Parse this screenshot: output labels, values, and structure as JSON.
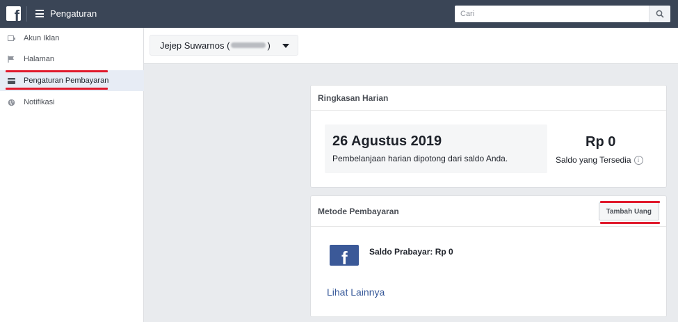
{
  "header": {
    "title": "Pengaturan",
    "search_placeholder": "Cari"
  },
  "sidebar": {
    "items": [
      {
        "label": "Akun Iklan",
        "icon": "ad-account-icon"
      },
      {
        "label": "Halaman",
        "icon": "flag-icon"
      },
      {
        "label": "Pengaturan Pembayaran",
        "icon": "credit-card-icon",
        "active": true
      },
      {
        "label": "Notifikasi",
        "icon": "globe-icon"
      }
    ]
  },
  "account": {
    "name_prefix": "Jejep Suwarnos (",
    "name_suffix": ")"
  },
  "summary": {
    "title": "Ringkasan Harian",
    "date": "26 Agustus 2019",
    "description": "Pembelanjaan harian dipotong dari saldo Anda.",
    "balance": "Rp 0",
    "balance_label": "Saldo yang Tersedia"
  },
  "payment": {
    "title": "Metode Pembayaran",
    "add_button": "Tambah Uang",
    "method_label": "Saldo Prabayar: Rp 0",
    "more_link": "Lihat Lainnya"
  },
  "colors": {
    "topbar": "#3a4556",
    "highlight": "#e0192c",
    "link": "#365899",
    "brand": "#3b5998"
  }
}
